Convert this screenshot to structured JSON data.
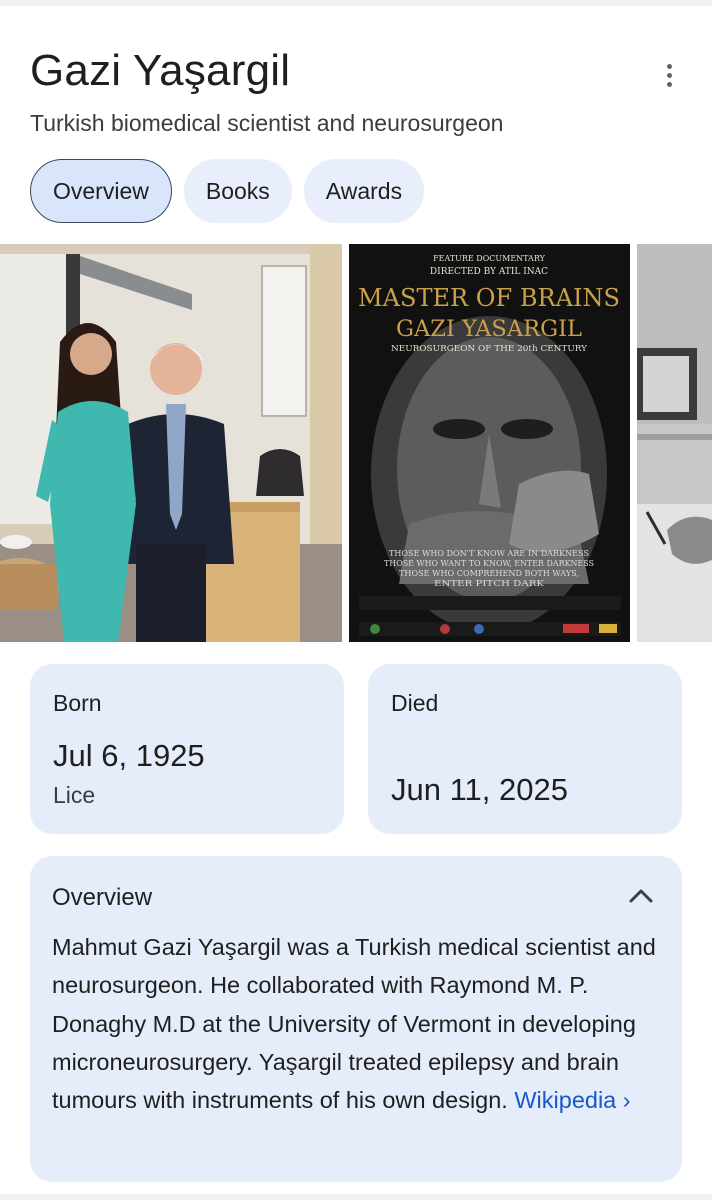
{
  "entity": {
    "title": "Gazi Yaşargil",
    "subtitle": "Turkish biomedical scientist and neurosurgeon",
    "more_icon": "more-vert-icon"
  },
  "tabs": [
    {
      "label": "Overview",
      "active": true
    },
    {
      "label": "Books",
      "active": false
    },
    {
      "label": "Awards",
      "active": false
    }
  ],
  "gallery": {
    "poster": {
      "tagline": "FEATURE DOCUMENTARY",
      "director": "DIRECTED BY ATIL INAC",
      "title_line1": "MASTER OF BRAINS",
      "title_line2": "GAZI YASARGIL",
      "title_line3": "NEUROSURGEON OF THE 20th CENTURY",
      "quote_line1": "THOSE WHO DON'T KNOW ARE IN DARKNESS",
      "quote_line2": "THOSE WHO WANT TO KNOW, ENTER DARKNESS",
      "quote_line3": "THOSE WHO COMPREHEND BOTH WAYS,",
      "quote_line4": "ENTER PITCH DARK"
    }
  },
  "facts": {
    "born": {
      "label": "Born",
      "value": "Jul 6, 1925",
      "place": "Lice"
    },
    "died": {
      "label": "Died",
      "value": "Jun 11, 2025"
    }
  },
  "overview": {
    "heading": "Overview",
    "text": "Mahmut Gazi Yaşargil was a Turkish medical scientist and neurosurgeon. He collaborated with Raymond M. P. Donaghy M.D at the University of Vermont in developing microneurosurgery. Yaşargil treated epilepsy and brain tumours with instruments of his own design.",
    "source_link": "Wikipedia ›"
  },
  "colors": {
    "accent_link": "#1a57c9",
    "chip_bg": "#e8eefb",
    "card_bg": "#e5ecfa"
  }
}
